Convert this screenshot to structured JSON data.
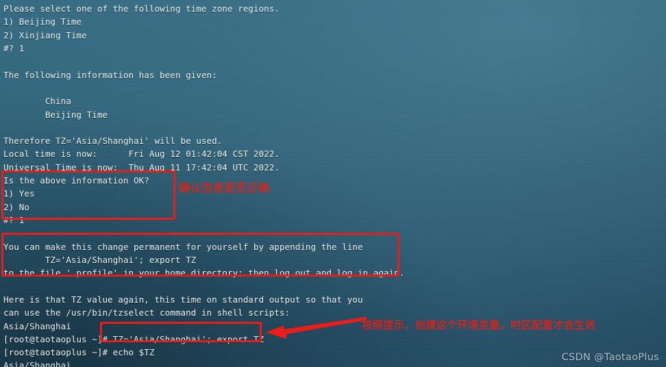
{
  "terminal": {
    "background_color": "#2e6179",
    "text_color": "#eef3f5",
    "lines": [
      "Please select one of the following time zone regions.",
      "1) Beijing Time",
      "2) Xinjiang Time",
      "#? 1",
      "",
      "The following information has been given:",
      "",
      "        China",
      "        Beijing Time",
      "",
      "Therefore TZ='Asia/Shanghai' will be used.",
      "Local time is now:      Fri Aug 12 01:42:04 CST 2022.",
      "Universal Time is now:  Thu Aug 11 17:42:04 UTC 2022.",
      "Is the above information OK?",
      "1) Yes",
      "2) No",
      "#? 1",
      "",
      "You can make this change permanent for yourself by appending the line",
      "        TZ='Asia/Shanghai'; export TZ",
      "to the file '.profile' in your home directory; then log out and log in again.",
      "",
      "Here is that TZ value again, this time on standard output so that you",
      "can use the /usr/bin/tzselect command in shell scripts:",
      "Asia/Shanghai",
      "[root@taotaoplus ~]# TZ='Asia/Shanghai'; export TZ",
      "[root@taotaoplus ~]# echo $TZ",
      "Asia/Shanghai"
    ]
  },
  "annotations": {
    "color": "#ee1c16",
    "boxes": [
      {
        "name": "confirm-prompt-box"
      },
      {
        "name": "permanent-change-box"
      },
      {
        "name": "export-command-box"
      }
    ],
    "notes": [
      {
        "text": "确认信息是否正确"
      },
      {
        "text": "按照提示，创建这个环境变量，时区配置才会生效"
      }
    ],
    "arrow": {
      "name": "pointer-arrow",
      "direction": "left"
    }
  },
  "watermark": {
    "text": "CSDN @TaotaoPlus"
  }
}
